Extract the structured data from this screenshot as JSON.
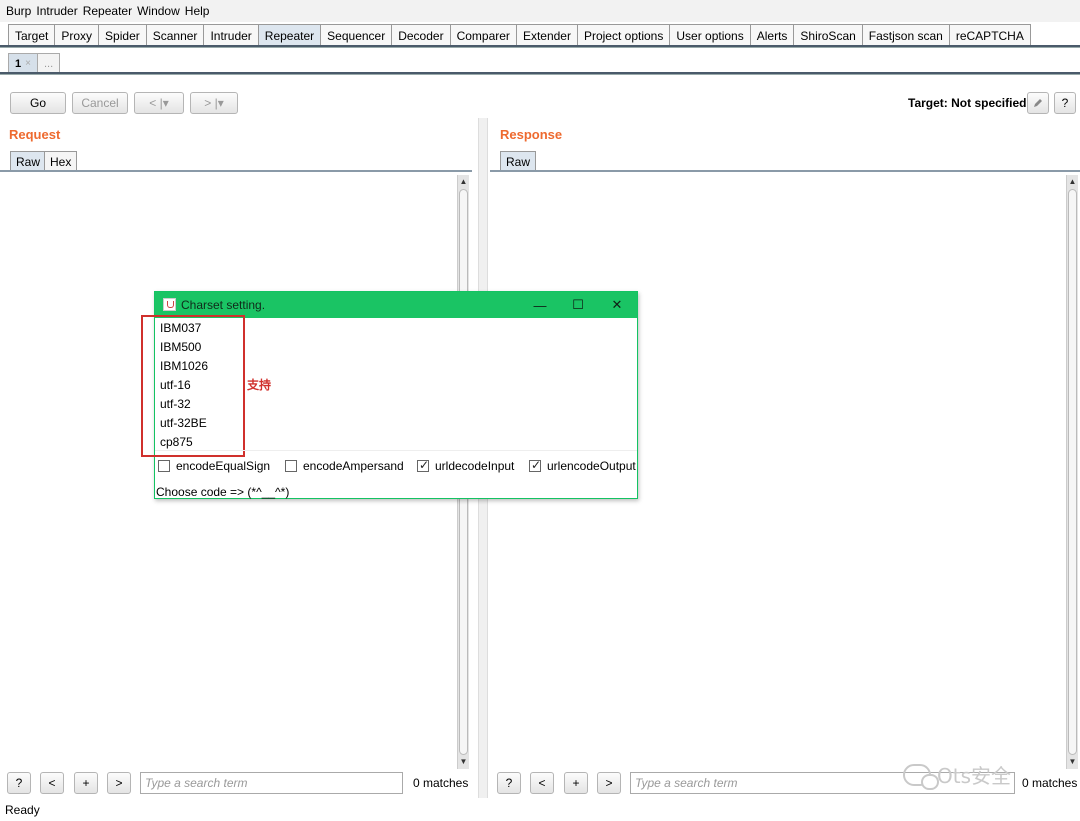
{
  "menu": [
    "Burp",
    "Intruder",
    "Repeater",
    "Window",
    "Help"
  ],
  "main_tabs": [
    "Target",
    "Proxy",
    "Spider",
    "Scanner",
    "Intruder",
    "Repeater",
    "Sequencer",
    "Decoder",
    "Comparer",
    "Extender",
    "Project options",
    "User options",
    "Alerts",
    "ShiroScan",
    "Fastjson scan",
    "reCAPTCHA"
  ],
  "active_main_tab": "Repeater",
  "sub_tabs": {
    "first": "1",
    "close": "×",
    "more": "..."
  },
  "toolbar": {
    "go": "Go",
    "cancel": "Cancel",
    "back": "< |▾",
    "forward": "> |▾",
    "target": "Target: Not specified",
    "help": "?"
  },
  "request": {
    "title": "Request",
    "tabs": [
      "Raw",
      "Hex"
    ]
  },
  "response": {
    "title": "Response",
    "tabs": [
      "Raw"
    ]
  },
  "search": {
    "placeholder": "Type a search term",
    "matches": "0 matches",
    "help": "?",
    "prev": "<",
    "add": "+",
    "next": ">"
  },
  "status": "Ready",
  "dialog": {
    "title": "Charset setting.",
    "controls": {
      "minimize": "—",
      "maximize": "☐",
      "close": "✕"
    },
    "charsets": [
      "IBM037",
      "IBM500",
      "IBM1026",
      "utf-16",
      "utf-32",
      "utf-32BE",
      "cp875"
    ],
    "annotation": "支持",
    "options": [
      {
        "label": "encodeEqualSign",
        "checked": false
      },
      {
        "label": "encodeAmpersand",
        "checked": false
      },
      {
        "label": "urldecodeInput",
        "checked": true
      },
      {
        "label": "urlencodeOutput",
        "checked": true
      }
    ],
    "footer": "Choose code => (*^__^*)"
  },
  "watermark": "Ots安全",
  "colors": {
    "section_title": "#ee6a2f",
    "dialog_title_bar": "#1ac464",
    "annotation_red": "#d0302c"
  }
}
